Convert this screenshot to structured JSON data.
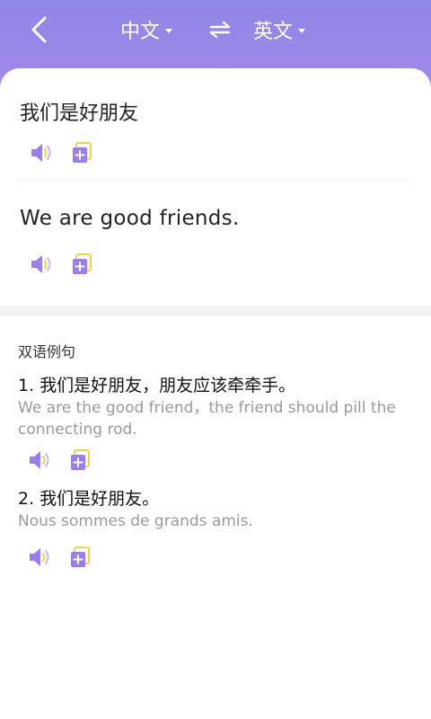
{
  "header": {
    "source_lang": "中文",
    "target_lang": "英文"
  },
  "translation": {
    "source": "我们是好朋友",
    "result": "We are good friends."
  },
  "examples": {
    "title": "双语例句",
    "items": [
      {
        "cn": "1. 我们是好朋友，朋友应该牵牵手。",
        "en": "We are the good friend，the friend should pill the connecting rod."
      },
      {
        "cn": "2. 我们是好朋友。",
        "en": "Nous sommes de grands amis."
      }
    ]
  },
  "colors": {
    "accent": "#9b7fe6",
    "copy_yellow": "#f2d24a"
  },
  "icons": [
    "back-icon",
    "swap-icon",
    "speaker-icon",
    "copy-icon"
  ]
}
